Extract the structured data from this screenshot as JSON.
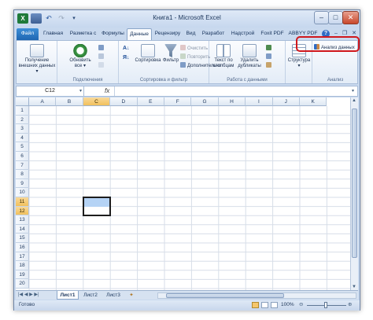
{
  "title": "Книга1 - Microsoft Excel",
  "window_controls": {
    "minimize": "–",
    "maximize": "□",
    "close": "✕"
  },
  "tabs": [
    "Файл",
    "Главная",
    "Разметка с",
    "Формулы",
    "Данные",
    "Рецензиру",
    "Вид",
    "Разработ",
    "Надстрой",
    "Foxit PDF",
    "ABBYY PDF"
  ],
  "ribbon": {
    "get_external_line1": "Получение",
    "get_external_line2": "внешних данных ▾",
    "refresh_line1": "Обновить",
    "refresh_line2": "все ▾",
    "group_connections": "Подключения",
    "sort": "Сортировка",
    "filter": "Фильтр",
    "clear": "Очистить",
    "reapply": "Повторить",
    "advanced": "Дополнительно",
    "group_sort_filter": "Сортировка и фильтр",
    "text_to_columns_line1": "Текст по",
    "text_to_columns_line2": "столбцам",
    "remove_dup_line1": "Удалить",
    "remove_dup_line2": "дубликаты",
    "group_data_tools": "Работа с данными",
    "outline": "Структура",
    "analysis_btn": "Анализ данных",
    "group_analysis": "Анализ"
  },
  "formula_bar": {
    "name_box": "C12",
    "fx": "fx",
    "value": ""
  },
  "columns": [
    "A",
    "B",
    "C",
    "D",
    "E",
    "F",
    "G",
    "H",
    "I",
    "J",
    "K"
  ],
  "rows": [
    "1",
    "2",
    "3",
    "4",
    "5",
    "6",
    "7",
    "8",
    "9",
    "10",
    "11",
    "12",
    "13",
    "14",
    "15",
    "16",
    "17",
    "18",
    "19",
    "20"
  ],
  "selection": {
    "column": "C",
    "rows": [
      "11",
      "12"
    ]
  },
  "sheets": [
    "Лист1",
    "Лист2",
    "Лист3"
  ],
  "status": {
    "ready": "Готово",
    "zoom": "100%"
  }
}
